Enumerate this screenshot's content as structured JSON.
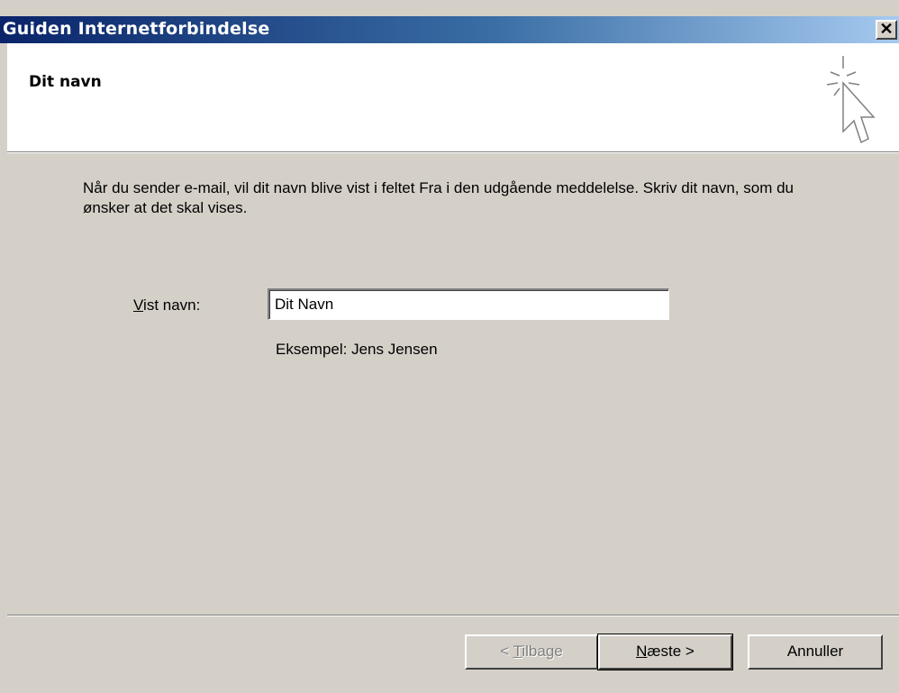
{
  "window": {
    "title": "Guiden Internetforbindelse",
    "close_glyph": "✕"
  },
  "header": {
    "title": "Dit navn",
    "icon": "wizard-cursor-icon"
  },
  "content": {
    "description": "Når du sender e-mail, vil dit navn blive vist i feltet Fra i den udgående meddelelse. Skriv dit navn, som du ønsker at det skal vises.",
    "field_label_access_key": "V",
    "field_label_rest": "ist navn:",
    "field_value": "Dit Navn",
    "example": "Eksempel: Jens Jensen"
  },
  "buttons": {
    "back_prefix": "< ",
    "back_access_key": "T",
    "back_rest": "ilbage",
    "next_access_key": "N",
    "next_rest": "æste >",
    "cancel": "Annuller"
  },
  "colors": {
    "title_gradient_start": "#0a246a",
    "title_gradient_end": "#a6caf0",
    "dialog_face": "#d4d0c8"
  }
}
